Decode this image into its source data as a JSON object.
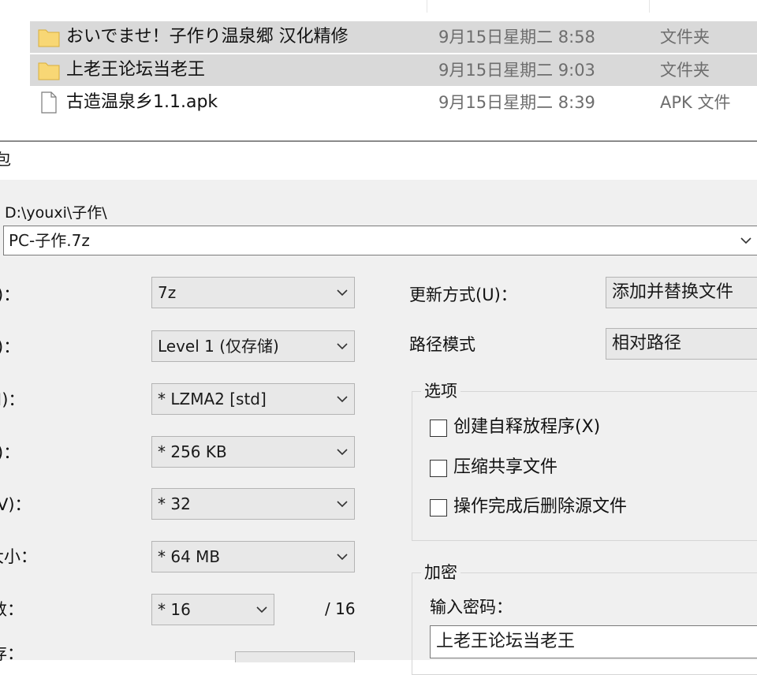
{
  "explorer": {
    "files": [
      {
        "name": "おいでませ！子作り温泉郷 汉化精修",
        "date": "9月15日星期二 8:58",
        "type": "文件夹",
        "icon": "folder-icon",
        "selected": true
      },
      {
        "name": "上老王论坛当老王",
        "date": "9月15日星期二 9:03",
        "type": "文件夹",
        "icon": "folder-icon",
        "selected": true
      },
      {
        "name": "古造温泉乡1.1.apk",
        "date": "9月15日星期二 8:39",
        "type": "APK 文件",
        "icon": "file-icon",
        "selected": false
      }
    ]
  },
  "dialog": {
    "title_fragment": "包",
    "path": "D:\\youxi\\子作\\",
    "archive_name": "PC-子作.7z",
    "left_labels": [
      ")：",
      ")：",
      "I)：",
      ")：",
      "V)：",
      "大小：",
      "数：",
      "存："
    ],
    "format": "7z",
    "level": "Level 1 (仅存储)",
    "method": "* LZMA2 [std]",
    "dictionary": "* 256 KB",
    "word_size": "* 32",
    "solid_block": "* 64 MB",
    "threads": "* 16",
    "threads_max": "/ 16",
    "update_mode_label": "更新方式(U)：",
    "update_mode_value": "添加并替换文件",
    "path_mode_label": "路径模式",
    "path_mode_value": "相对路径",
    "options": {
      "title": "选项",
      "create_sfx": "创建自释放程序(X)",
      "compress_shared": "压缩共享文件",
      "delete_after": "操作完成后删除源文件"
    },
    "encryption": {
      "title": "加密",
      "enter_password_label": "输入密码：",
      "password_value": "上老王论坛当老王"
    }
  },
  "colors": {
    "selection": "#d9d9d9",
    "folder": "#f8d775",
    "dialog_bg": "#f0f0f0"
  }
}
